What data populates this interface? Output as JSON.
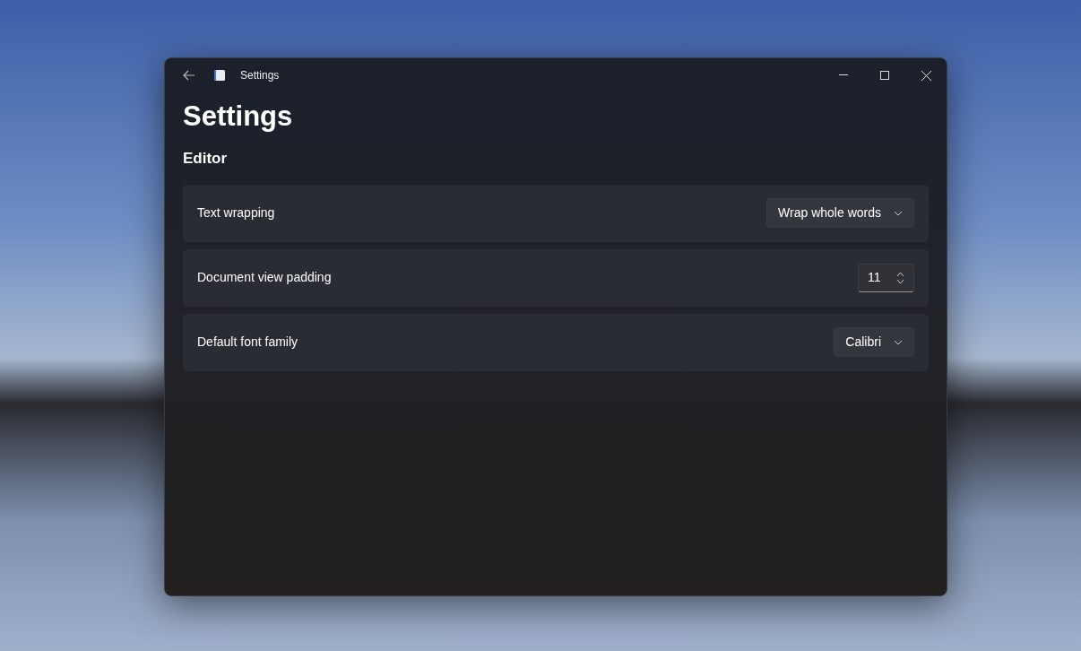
{
  "window": {
    "title": "Settings"
  },
  "page_title": "Settings",
  "section": "Editor",
  "settings": [
    {
      "kind": "dropdown",
      "label": "Text wrapping",
      "value": "Wrap whole words"
    },
    {
      "kind": "number",
      "label": "Document view padding",
      "value": "11"
    },
    {
      "kind": "dropdown",
      "label": "Default font family",
      "value": "Calibri"
    }
  ]
}
